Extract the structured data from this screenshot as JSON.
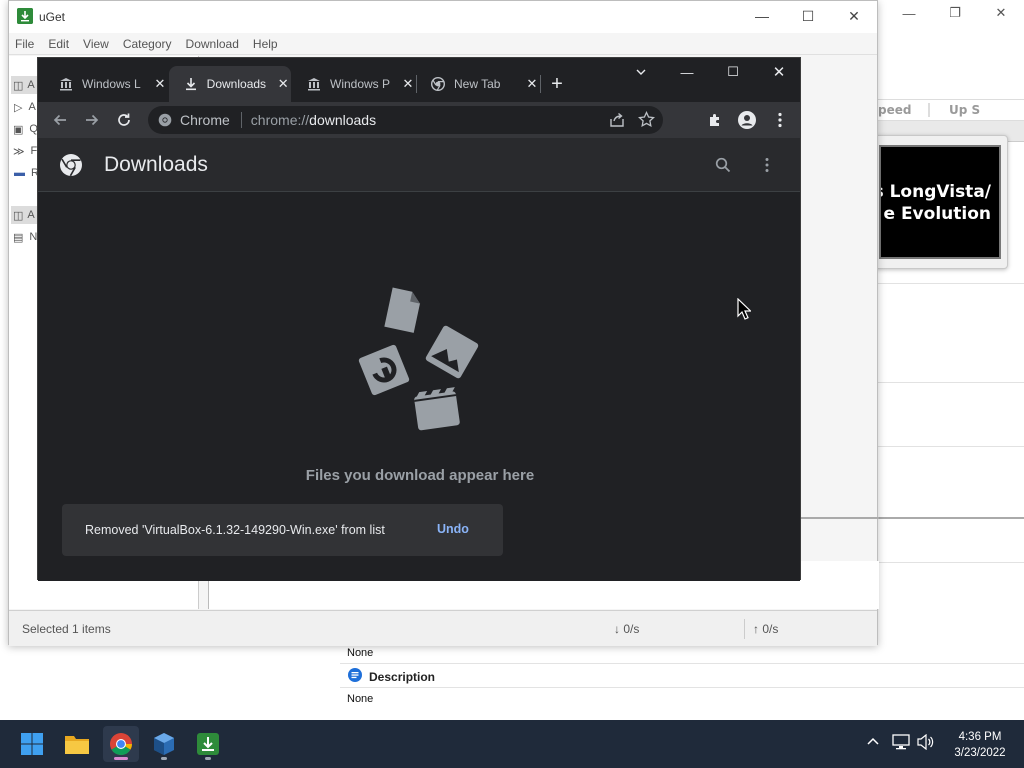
{
  "background_window": {
    "columns": {
      "speed": "peed",
      "up_speed": "Up S"
    },
    "thumbnail_text_line1": "s LongVista/",
    "thumbnail_text_line2": "e Evolution",
    "properties": {
      "first_value": "None",
      "description_label": "Description",
      "description_value": "None"
    }
  },
  "uget": {
    "title": "uGet",
    "menu": [
      "File",
      "Edit",
      "View",
      "Category",
      "Download",
      "Help"
    ],
    "sidebar_letters": [
      "A",
      "Q",
      "F",
      "R",
      "A",
      "N"
    ],
    "status": {
      "selected": "Selected 1 items",
      "down_speed": "↓ 0/s",
      "up_speed": "↑ 0/s"
    }
  },
  "chrome": {
    "tabs": [
      {
        "label": "Windows L",
        "icon": "museum-icon",
        "active": false
      },
      {
        "label": "Downloads",
        "icon": "download-icon",
        "active": true
      },
      {
        "label": "Windows P",
        "icon": "museum-icon",
        "active": false
      },
      {
        "label": "New Tab",
        "icon": "chrome-icon",
        "active": false
      }
    ],
    "omnibox": {
      "site": "Chrome",
      "url_scheme": "chrome://",
      "url_host": "downloads"
    },
    "page_title": "Downloads",
    "empty_message": "Files you download appear here",
    "toast": {
      "message": "Removed 'VirtualBox-6.1.32-149290-Win.exe' from list",
      "action": "Undo"
    }
  },
  "taskbar": {
    "apps": [
      "start-icon",
      "file-explorer-icon",
      "chrome-icon",
      "virtualbox-icon",
      "uget-icon"
    ],
    "clock": {
      "time": "4:36 PM",
      "date": "3/23/2022"
    }
  },
  "colors": {
    "chrome_bg": "#202124",
    "chrome_toolbar": "#35363a",
    "link_blue": "#8ab4f8",
    "taskbar": "#1f2a3a"
  }
}
